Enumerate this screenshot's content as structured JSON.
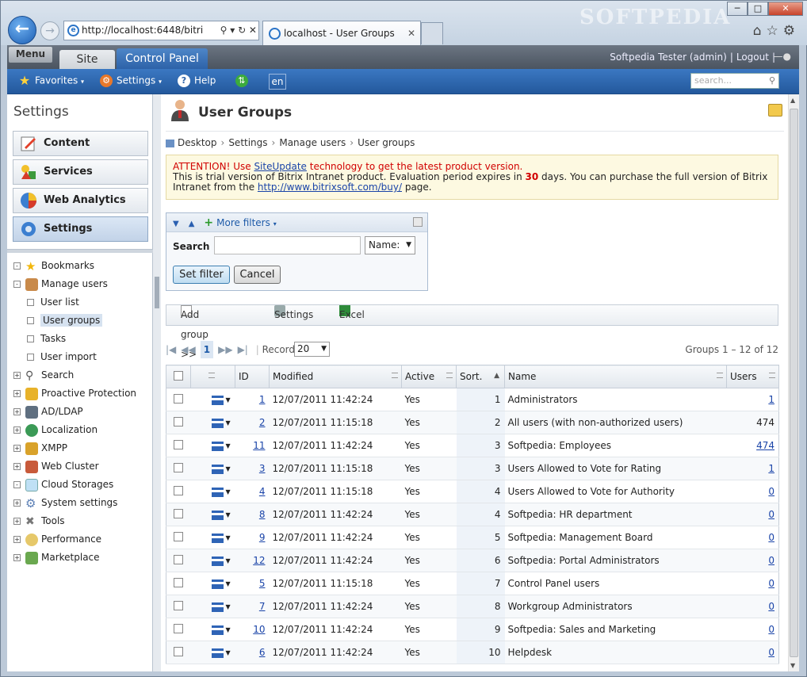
{
  "browser": {
    "url": "http://localhost:6448/bitri",
    "tab_title": "localhost - User Groups",
    "watermark": "SOFTPEDIA"
  },
  "topbar": {
    "menu": "Menu",
    "tab_site": "Site",
    "tab_control_panel": "Control Panel",
    "user": "Softpedia Tester (admin)",
    "logout": "Logout"
  },
  "toolbar": {
    "favorites": "Favorites",
    "settings": "Settings",
    "help": "Help",
    "lang": "en",
    "search_placeholder": "search..."
  },
  "sidebar": {
    "title": "Settings",
    "sections": [
      "Content",
      "Services",
      "Web Analytics",
      "Settings"
    ],
    "tree": [
      {
        "label": "Bookmarks",
        "toggle": "-"
      },
      {
        "label": "Manage users",
        "toggle": "-"
      },
      {
        "label": "User list",
        "sub": true
      },
      {
        "label": "User groups",
        "sub": true,
        "selected": true
      },
      {
        "label": "Tasks",
        "sub": true
      },
      {
        "label": "User import",
        "sub": true
      },
      {
        "label": "Search",
        "toggle": "+"
      },
      {
        "label": "Proactive Protection",
        "toggle": "+"
      },
      {
        "label": "AD/LDAP",
        "toggle": "+"
      },
      {
        "label": "Localization",
        "toggle": "+"
      },
      {
        "label": "XMPP",
        "toggle": "+"
      },
      {
        "label": "Web Cluster",
        "toggle": "+"
      },
      {
        "label": "Cloud Storages",
        "toggle": "-"
      },
      {
        "label": "System settings",
        "toggle": "+"
      },
      {
        "label": "Tools",
        "toggle": "+"
      },
      {
        "label": "Performance",
        "toggle": "+"
      },
      {
        "label": "Marketplace",
        "toggle": "+"
      }
    ]
  },
  "main": {
    "title": "User Groups",
    "breadcrumb": [
      "Desktop",
      "Settings",
      "Manage users",
      "User groups"
    ],
    "alert": {
      "l1a": "ATTENTION! Use ",
      "l1link": "SiteUpdate",
      "l1b": " technology to get the latest product version.",
      "l2a": "This is trial version of Bitrix Intranet product. Evaluation period expires in ",
      "days": "30",
      "l2b": " days. You can purchase the full version of Bitrix Intranet from the ",
      "link": "http://www.bitrixsoft.com/buy/",
      "l2c": " page."
    },
    "filter": {
      "more_filters": "More filters",
      "search_label": "Search",
      "field_select": "Name:",
      "set_filter": "Set filter",
      "cancel": "Cancel"
    },
    "actions": {
      "add_group": "Add group >>",
      "settings": "Settings",
      "excel": "Excel"
    },
    "pager": {
      "page": "1",
      "records_label": "Records:",
      "records": "20",
      "count": "Groups 1 – 12 of 12"
    },
    "columns": [
      "ID",
      "Modified",
      "Active",
      "Sort.",
      "Name",
      "Users"
    ],
    "rows": [
      {
        "id": "1",
        "modified": "12/07/2011 11:42:24",
        "active": "Yes",
        "sort": "1",
        "name": "Administrators",
        "users": "1",
        "users_link": true
      },
      {
        "id": "2",
        "modified": "12/07/2011 11:15:18",
        "active": "Yes",
        "sort": "2",
        "name": "All users (with non-authorized users)",
        "users": "474",
        "users_link": false
      },
      {
        "id": "11",
        "modified": "12/07/2011 11:42:24",
        "active": "Yes",
        "sort": "3",
        "name": "Softpedia: Employees",
        "users": "474",
        "users_link": true
      },
      {
        "id": "3",
        "modified": "12/07/2011 11:15:18",
        "active": "Yes",
        "sort": "3",
        "name": "Users Allowed to Vote for Rating",
        "users": "1",
        "users_link": true
      },
      {
        "id": "4",
        "modified": "12/07/2011 11:15:18",
        "active": "Yes",
        "sort": "4",
        "name": "Users Allowed to Vote for Authority",
        "users": "0",
        "users_link": true
      },
      {
        "id": "8",
        "modified": "12/07/2011 11:42:24",
        "active": "Yes",
        "sort": "4",
        "name": "Softpedia: HR department",
        "users": "0",
        "users_link": true
      },
      {
        "id": "9",
        "modified": "12/07/2011 11:42:24",
        "active": "Yes",
        "sort": "5",
        "name": "Softpedia: Management Board",
        "users": "0",
        "users_link": true
      },
      {
        "id": "12",
        "modified": "12/07/2011 11:42:24",
        "active": "Yes",
        "sort": "6",
        "name": "Softpedia: Portal Administrators",
        "users": "0",
        "users_link": true
      },
      {
        "id": "5",
        "modified": "12/07/2011 11:15:18",
        "active": "Yes",
        "sort": "7",
        "name": "Control Panel users",
        "users": "0",
        "users_link": true
      },
      {
        "id": "7",
        "modified": "12/07/2011 11:42:24",
        "active": "Yes",
        "sort": "8",
        "name": "Workgroup Administrators",
        "users": "0",
        "users_link": true
      },
      {
        "id": "10",
        "modified": "12/07/2011 11:42:24",
        "active": "Yes",
        "sort": "9",
        "name": "Softpedia: Sales and Marketing",
        "users": "0",
        "users_link": true
      },
      {
        "id": "6",
        "modified": "12/07/2011 11:42:24",
        "active": "Yes",
        "sort": "10",
        "name": "Helpdesk",
        "users": "0",
        "users_link": true
      }
    ]
  }
}
